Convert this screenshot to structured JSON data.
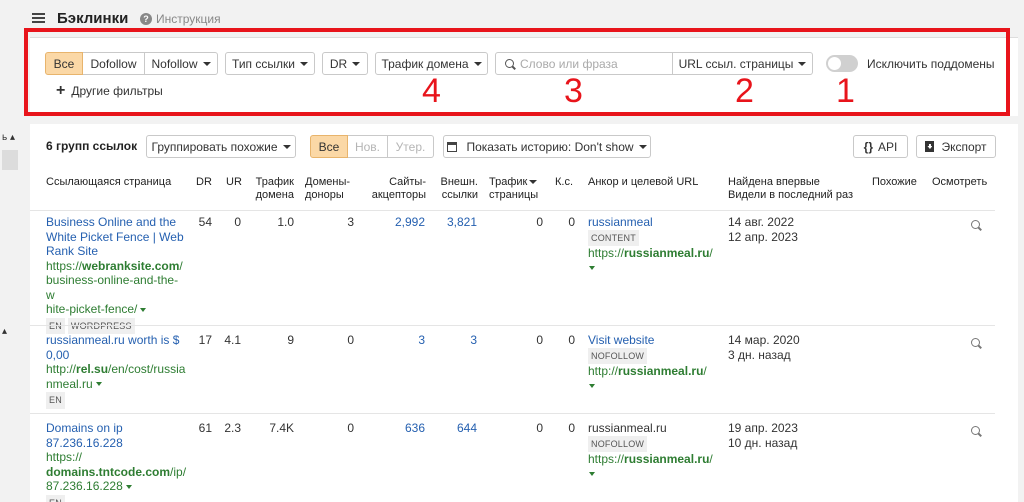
{
  "header": {
    "title": "Бэклинки",
    "help_label": "Инструкция"
  },
  "filters": {
    "all_label": "Все",
    "dofollow_label": "Dofollow",
    "nofollow_label": "Nofollow",
    "link_type_label": "Тип ссылки",
    "dr_label": "DR",
    "domain_traffic_label": "Трафик домена",
    "search_placeholder": "Слово или фраза",
    "url_mode_label": "URL ссыл. страницы",
    "exclude_subdomains_label": "Исключить поддомены",
    "exclude_subdomains_on": false,
    "more_filters_label": "Другие фильтры"
  },
  "annotations": {
    "marker_1": "1",
    "marker_2": "2",
    "marker_3": "3",
    "marker_4": "4",
    "highlight_color": "#e8141b"
  },
  "toolbar": {
    "groups_count": "6 групп ссылок",
    "group_similar_label": "Группировать похожие",
    "seg_all": "Все",
    "seg_new": "Нов.",
    "seg_lost": "Утер.",
    "history_label": "Показать историю: Don't show",
    "api_label": "API",
    "export_label": "Экспорт"
  },
  "table": {
    "headers": {
      "page": "Ссылающаяся страница",
      "dr": "DR",
      "ur": "UR",
      "traffic_1": "Трафик",
      "traffic_2": "домена",
      "donors_1": "Домены-",
      "donors_2": "доноры",
      "acceptors_1": "Сайты-",
      "acceptors_2": "акцепторы",
      "ext_1": "Внешн.",
      "ext_2": "ссылки",
      "page_traffic_1": "Трафик",
      "page_traffic_2": "страницы",
      "ks": "К.с.",
      "anchor": "Анкор и целевой URL",
      "found_1": "Найдена впервые",
      "found_2": "Видели в последний раз",
      "similar": "Похожие",
      "inspect": "Осмотреть"
    },
    "rows": [
      {
        "title_lines": [
          "Business Online and the",
          "White Picket Fence | Web",
          "Rank Site"
        ],
        "url_prefix": "https://",
        "url_domain": "webranksite.com",
        "url_rest_1": "/",
        "url_lines": [
          "business-online-and-the-w",
          "hite-picket-fence/"
        ],
        "badges": [
          "EN",
          "WORDPRESS"
        ],
        "dr": "54",
        "ur": "0",
        "traffic": "1.0",
        "donors": "3",
        "acceptors": "2,992",
        "ext": "3,821",
        "page_traffic": "0",
        "ks": "0",
        "anchor": "russianmeal",
        "anchor_badge": "CONTENT",
        "target_prefix": "https://",
        "target_domain": "russianmeal.ru",
        "target_rest": "/",
        "first_seen": "14 авг. 2022",
        "last_seen": "12 апр. 2023"
      },
      {
        "title_lines": [
          "russianmeal.ru worth is $",
          "0,00"
        ],
        "url_prefix": "http://",
        "url_domain": "rel.su",
        "url_rest_1": "/en/cost/russia",
        "url_lines": [
          "nmeal.ru"
        ],
        "badges": [
          "EN"
        ],
        "dr": "17",
        "ur": "4.1",
        "traffic": "9",
        "donors": "0",
        "acceptors": "3",
        "ext": "3",
        "page_traffic": "0",
        "ks": "0",
        "anchor": "Visit website",
        "anchor_badge": "NOFOLLOW",
        "target_prefix": "http://",
        "target_domain": "russianmeal.ru",
        "target_rest": "/",
        "first_seen": "14 мар. 2020",
        "last_seen": "3 дн. назад"
      },
      {
        "title_lines": [
          "Domains on ip",
          "87.236.16.228"
        ],
        "url_prefix": "https://",
        "url_domain": "domains.tntcode.com",
        "url_rest_1": "/ip/",
        "url_lines": [
          "87.236.16.228"
        ],
        "badges": [
          "EN"
        ],
        "dr": "61",
        "ur": "2.3",
        "traffic": "7.4K",
        "donors": "0",
        "acceptors": "636",
        "ext": "644",
        "page_traffic": "0",
        "ks": "0",
        "anchor": "russianmeal.ru",
        "anchor_badge": "NOFOLLOW",
        "target_prefix": "https://",
        "target_domain": "russianmeal.ru",
        "target_rest": "/",
        "first_seen": "19 апр. 2023",
        "last_seen": "10 дн. назад"
      }
    ]
  }
}
